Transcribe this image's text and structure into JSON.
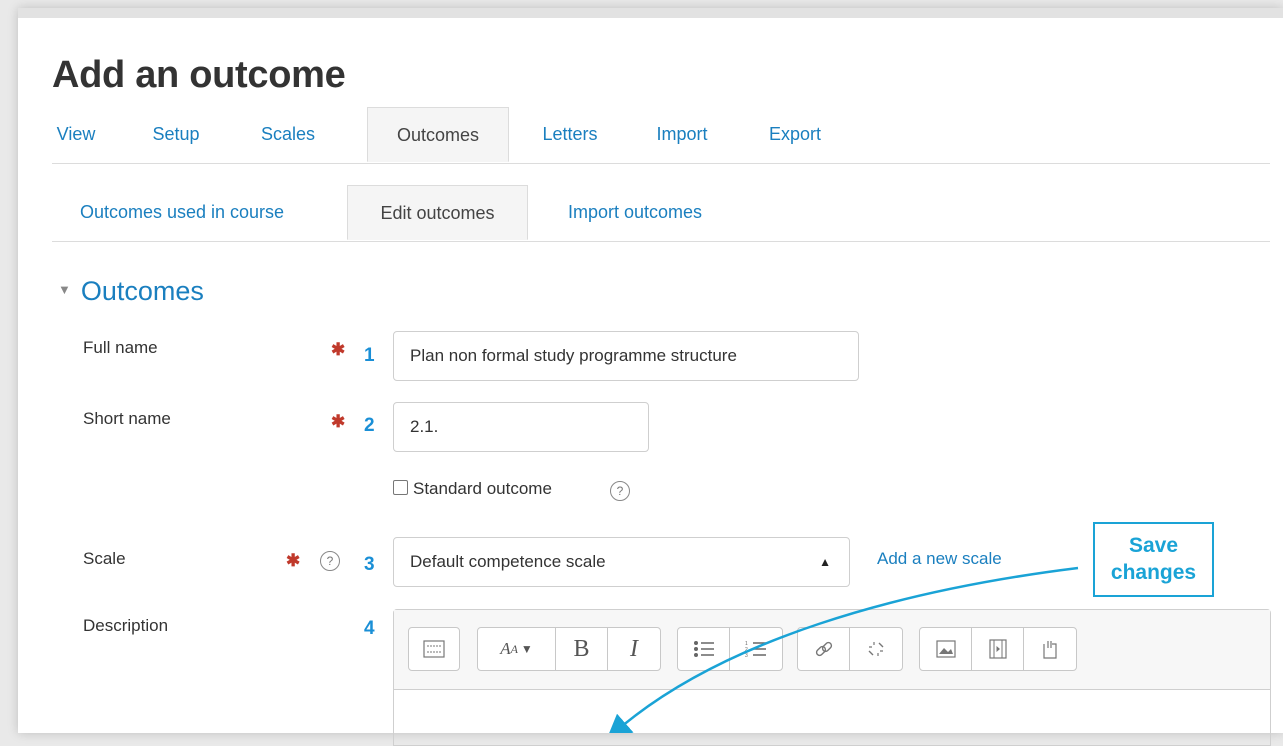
{
  "page": {
    "title": "Add an outcome"
  },
  "primary_tabs": [
    "View",
    "Setup",
    "Scales",
    "Outcomes",
    "Letters",
    "Import",
    "Export"
  ],
  "primary_active": "Outcomes",
  "secondary_tabs": [
    "Outcomes used in course",
    "Edit outcomes",
    "Import outcomes"
  ],
  "secondary_active": "Edit outcomes",
  "section": {
    "title": "Outcomes"
  },
  "form": {
    "full_name": {
      "label": "Full name",
      "step": "1",
      "value": "Plan non formal study programme structure"
    },
    "short_name": {
      "label": "Short name",
      "step": "2",
      "value": "2.1."
    },
    "standard_outcome": {
      "label": "Standard outcome",
      "checked": false
    },
    "scale": {
      "label": "Scale",
      "step": "3",
      "value": "Default competence scale",
      "add_link": "Add a new scale"
    },
    "description": {
      "label": "Description",
      "step": "4"
    }
  },
  "callout": {
    "line1": "Save",
    "line2": "changes"
  },
  "colors": {
    "link": "#1a7fbf",
    "required": "#c0392b",
    "callout": "#1aa3d6"
  },
  "icons": {
    "required": "asterisk-icon",
    "help": "question-mark-icon",
    "editor_toolbar": [
      "toolbar-toggle-icon",
      "font-style-icon",
      "bold-icon",
      "italic-icon",
      "unordered-list-icon",
      "ordered-list-icon",
      "link-icon",
      "unlink-icon",
      "image-icon",
      "media-icon",
      "manage-files-icon"
    ]
  }
}
